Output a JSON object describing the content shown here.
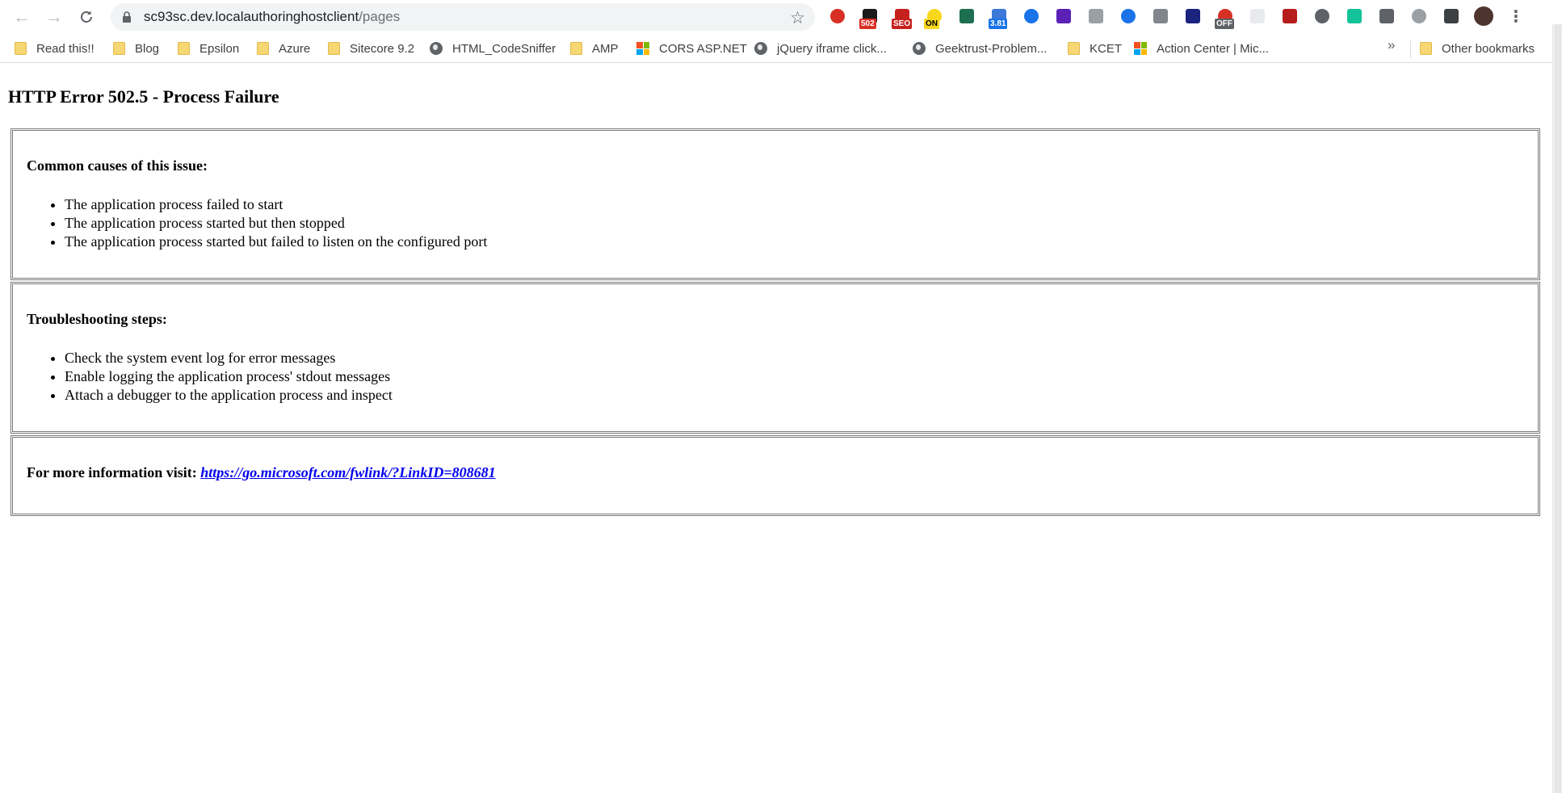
{
  "browser": {
    "address_bar": {
      "domain": "sc93sc.dev.localauthoringhostclient",
      "path": "/pages"
    },
    "extensions": [
      {
        "icon": "target-icon",
        "color": "#d93025",
        "badge": ""
      },
      {
        "icon": "pen-icon",
        "color": "#1a1a1a",
        "badge": "502",
        "badge_color": "#d93025"
      },
      {
        "icon": "seo-icon",
        "color": "#c5221f",
        "badge": "SEO"
      },
      {
        "icon": "on-icon",
        "color": "#f9d71c",
        "badge": "ON"
      },
      {
        "icon": "square-icon",
        "color": "#1e6f52",
        "badge": ""
      },
      {
        "icon": "speed-icon",
        "color": "#3c78d8",
        "badge": "3.81",
        "badge_color": "#1a73e8"
      },
      {
        "icon": "eye-icon",
        "color": "#1a73e8",
        "badge": ""
      },
      {
        "icon": "layers-icon",
        "color": "#5b21b6",
        "badge": ""
      },
      {
        "icon": "cog-icon",
        "color": "#9aa0a6",
        "badge": ""
      },
      {
        "icon": "bracket-icon",
        "color": "#1a73e8",
        "badge": ""
      },
      {
        "icon": "bolt-icon",
        "color": "#80868b",
        "badge": ""
      },
      {
        "icon": "monitor-icon",
        "color": "#1a237e",
        "badge": ""
      },
      {
        "icon": "chart-icon",
        "color": "#d93025",
        "badge": "OFF",
        "badge_color": "#5f6368"
      },
      {
        "icon": "blank-icon",
        "color": "#e8eaed",
        "badge": ""
      },
      {
        "icon": "bug-icon",
        "color": "#b71c1c",
        "badge": ""
      },
      {
        "icon": "check-icon",
        "color": "#5f6368",
        "badge": ""
      },
      {
        "icon": "grammarly-icon",
        "color": "#15c39a",
        "badge": ""
      },
      {
        "icon": "gear-icon",
        "color": "#5f6368",
        "badge": ""
      },
      {
        "icon": "vue-icon",
        "color": "#9aa0a6",
        "badge": ""
      },
      {
        "icon": "media-icon",
        "color": "#3c4043",
        "badge": ""
      },
      {
        "icon": "avatar-icon",
        "color": "#4e342e",
        "badge": ""
      },
      {
        "icon": "more-vert-icon",
        "color": "#5f6368",
        "badge": ""
      }
    ],
    "bookmarks": [
      {
        "label": "Read this!!",
        "icon": "folder-icon"
      },
      {
        "label": "Blog",
        "icon": "folder-icon"
      },
      {
        "label": "Epsilon",
        "icon": "folder-icon"
      },
      {
        "label": "Azure",
        "icon": "folder-icon"
      },
      {
        "label": "Sitecore 9.2",
        "icon": "folder-icon"
      },
      {
        "label": "HTML_CodeSniffer",
        "icon": "globe-icon"
      },
      {
        "label": "AMP",
        "icon": "folder-icon"
      },
      {
        "label": "CORS ASP.NET",
        "icon": "microsoft-icon"
      },
      {
        "label": "jQuery iframe click...",
        "icon": "globe-icon"
      },
      {
        "label": "Geektrust-Problem...",
        "icon": "globe-icon"
      },
      {
        "label": "KCET",
        "icon": "folder-icon"
      },
      {
        "label": "Action Center | Mic...",
        "icon": "microsoft-icon"
      }
    ],
    "overflow_label": "»",
    "other_bookmarks": "Other bookmarks"
  },
  "page": {
    "title": "HTTP Error 502.5 - Process Failure",
    "causes": {
      "heading": "Common causes of this issue:",
      "items": [
        "The application process failed to start",
        "The application process started but then stopped",
        "The application process started but failed to listen on the configured port"
      ]
    },
    "troubleshooting": {
      "heading": "Troubleshooting steps:",
      "items": [
        "Check the system event log for error messages",
        "Enable logging the application process' stdout messages",
        "Attach a debugger to the application process and inspect"
      ]
    },
    "more_info": {
      "label": "For more information visit:",
      "link": "https://go.microsoft.com/fwlink/?LinkID=808681"
    }
  }
}
